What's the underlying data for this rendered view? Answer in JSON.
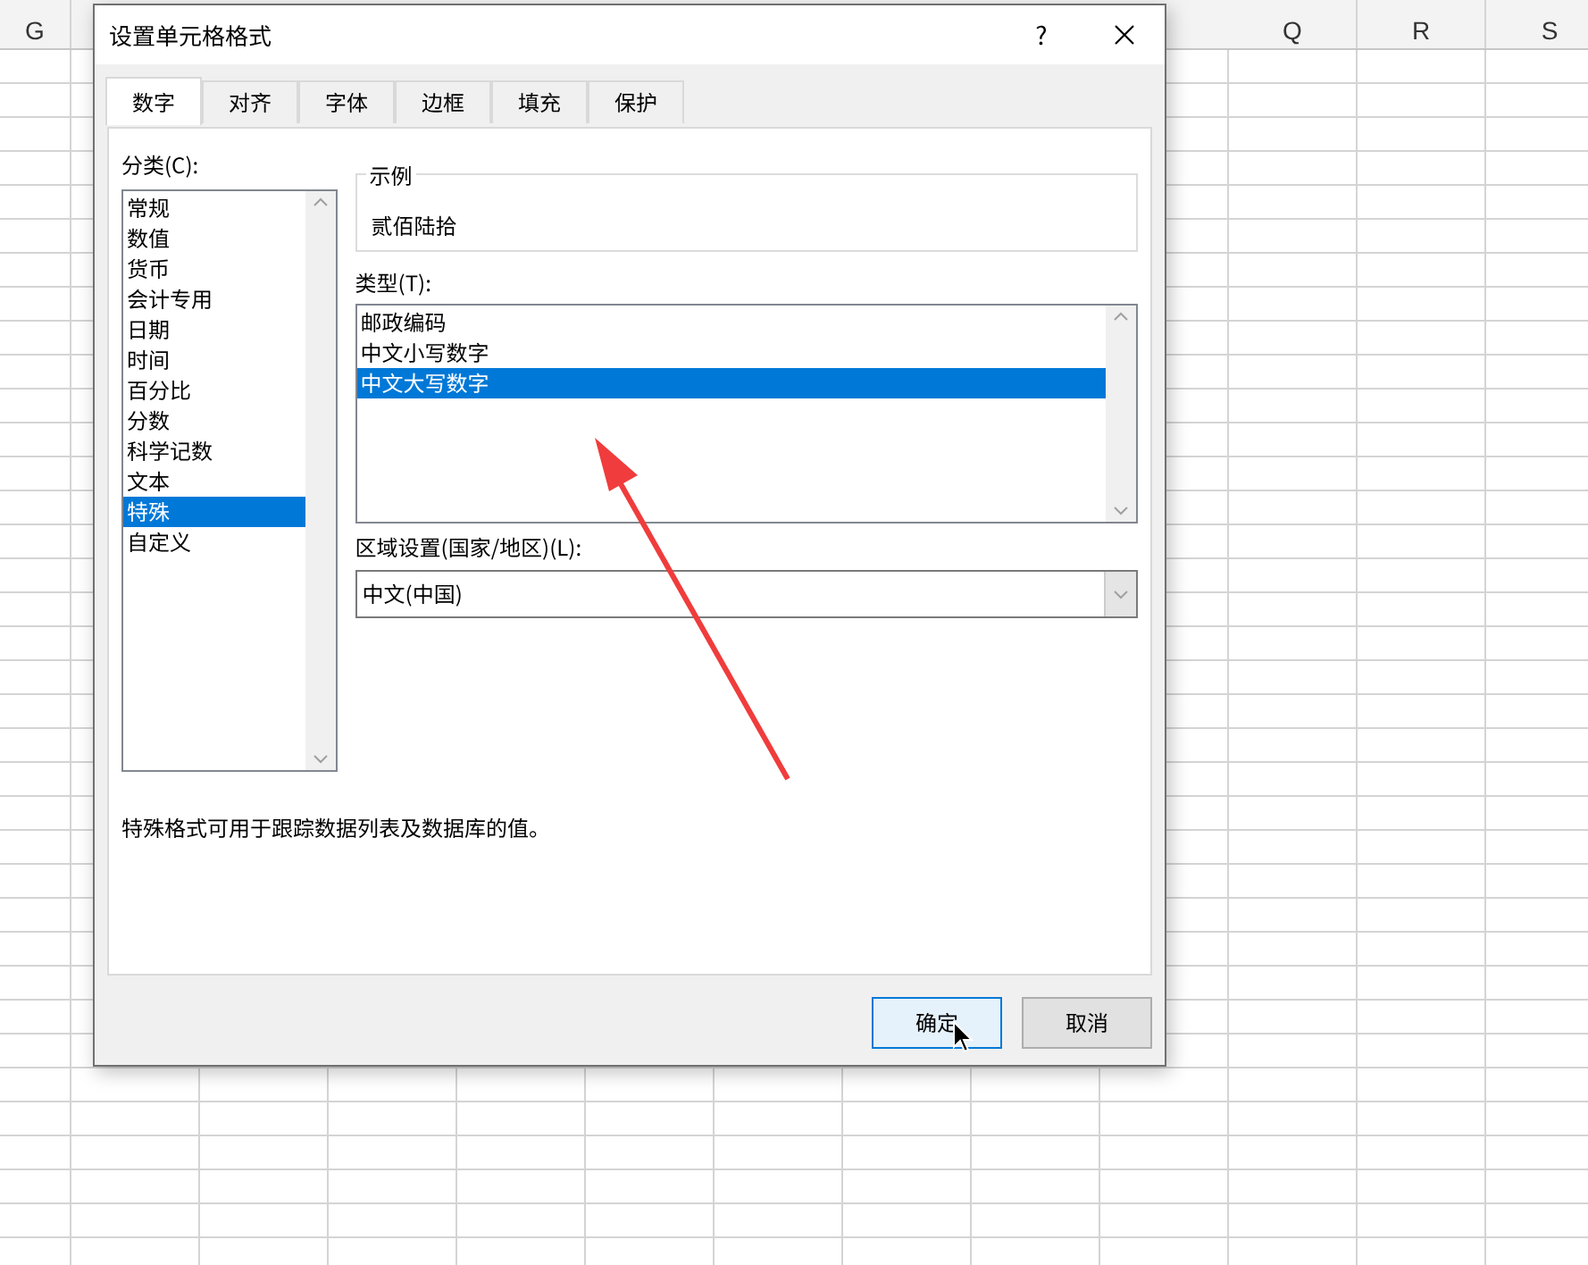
{
  "sheet": {
    "column_headers": [
      {
        "label": "G"
      },
      {
        "label": "Q"
      },
      {
        "label": "R"
      },
      {
        "label": "S"
      }
    ]
  },
  "dialog": {
    "title": "设置单元格格式",
    "help_button": "?",
    "tabs": [
      {
        "label": "数字",
        "selected": true
      },
      {
        "label": "对齐",
        "selected": false
      },
      {
        "label": "字体",
        "selected": false
      },
      {
        "label": "边框",
        "selected": false
      },
      {
        "label": "填充",
        "selected": false
      },
      {
        "label": "保护",
        "selected": false
      }
    ],
    "category": {
      "label": "分类(C):",
      "items": [
        {
          "label": "常规",
          "selected": false
        },
        {
          "label": "数值",
          "selected": false
        },
        {
          "label": "货币",
          "selected": false
        },
        {
          "label": "会计专用",
          "selected": false
        },
        {
          "label": "日期",
          "selected": false
        },
        {
          "label": "时间",
          "selected": false
        },
        {
          "label": "百分比",
          "selected": false
        },
        {
          "label": "分数",
          "selected": false
        },
        {
          "label": "科学记数",
          "selected": false
        },
        {
          "label": "文本",
          "selected": false
        },
        {
          "label": "特殊",
          "selected": true
        },
        {
          "label": "自定义",
          "selected": false
        }
      ]
    },
    "sample": {
      "legend": "示例",
      "value": "贰佰陆拾"
    },
    "type": {
      "label": "类型(T):",
      "items": [
        {
          "label": "邮政编码",
          "selected": false
        },
        {
          "label": "中文小写数字",
          "selected": false
        },
        {
          "label": "中文大写数字",
          "selected": true
        }
      ]
    },
    "locale": {
      "label": "区域设置(国家/地区)(L):",
      "value": "中文(中国)"
    },
    "description": "特殊格式可用于跟踪数据列表及数据库的值。",
    "buttons": [
      {
        "label": "确定",
        "default": true
      },
      {
        "label": "取消",
        "default": false
      }
    ]
  }
}
